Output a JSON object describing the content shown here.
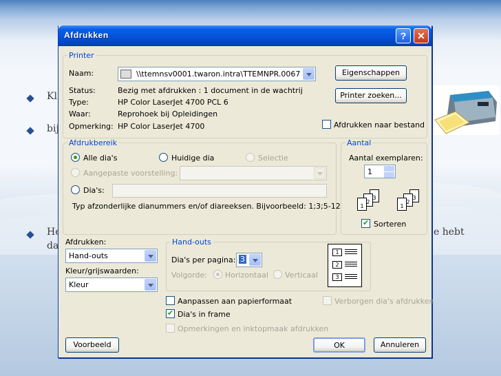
{
  "slide": {
    "bullets": [
      "Kl",
      "bij",
      "He",
      "da"
    ],
    "right_text": "e hebt"
  },
  "dialog": {
    "title": "Afdrukken",
    "help_glyph": "?",
    "close_glyph": "✕",
    "printer_group": {
      "title": "Printer",
      "name_label": "Naam:",
      "name_value": "\\\\ttemnsv0001.twaron.intra\\TTEMNPR.0067",
      "status_label": "Status:",
      "status_value": "Bezig met afdrukken : 1 document in de wachtrij",
      "type_label": "Type:",
      "type_value": "HP Color LaserJet 4700 PCL 6",
      "where_label": "Waar:",
      "where_value": "Reprohoek bij Opleidingen",
      "comment_label": "Opmerking:",
      "comment_value": "HP Color LaserJet 4700",
      "properties_button": "Eigenschappen",
      "find_button": "Printer zoeken...",
      "print_to_file": "Afdrukken naar bestand"
    },
    "range_group": {
      "title": "Afdrukbereik",
      "all": "Alle dia's",
      "current": "Huidige dia",
      "selection": "Selectie",
      "custom": "Aangepaste voorstelling:",
      "slides": "Dia's:",
      "hint": "Typ afzonderlijke dianummers en/of diareeksen. Bijvoorbeeld: 1;3;5-12"
    },
    "copies_group": {
      "title": "Aantal",
      "count_label": "Aantal exemplaren:",
      "count_value": "1",
      "collate": "Sorteren",
      "pages": [
        "1",
        "2",
        "3",
        "1",
        "2",
        "3"
      ]
    },
    "print_what_label": "Afdrukken:",
    "print_what_value": "Hand-outs",
    "color_label": "Kleur/grijswaarden:",
    "color_value": "Kleur",
    "handouts_group": {
      "title": "Hand-outs",
      "per_page_label": "Dia's per pagina:",
      "per_page_value": "3",
      "order_label": "Volgorde:",
      "horizontal": "Horizontaal",
      "vertical": "Verticaal",
      "preview_numbers": [
        "1",
        "2",
        "3"
      ]
    },
    "fit_paper": "Aanpassen aan papierformaat",
    "hidden_slides": "Verborgen dia's afdrukken",
    "frame": "Dia's in frame",
    "comments": "Opmerkingen en inktopmaak afdrukken",
    "preview_button": "Voorbeeld",
    "ok_button": "OK",
    "cancel_button": "Annuleren"
  }
}
